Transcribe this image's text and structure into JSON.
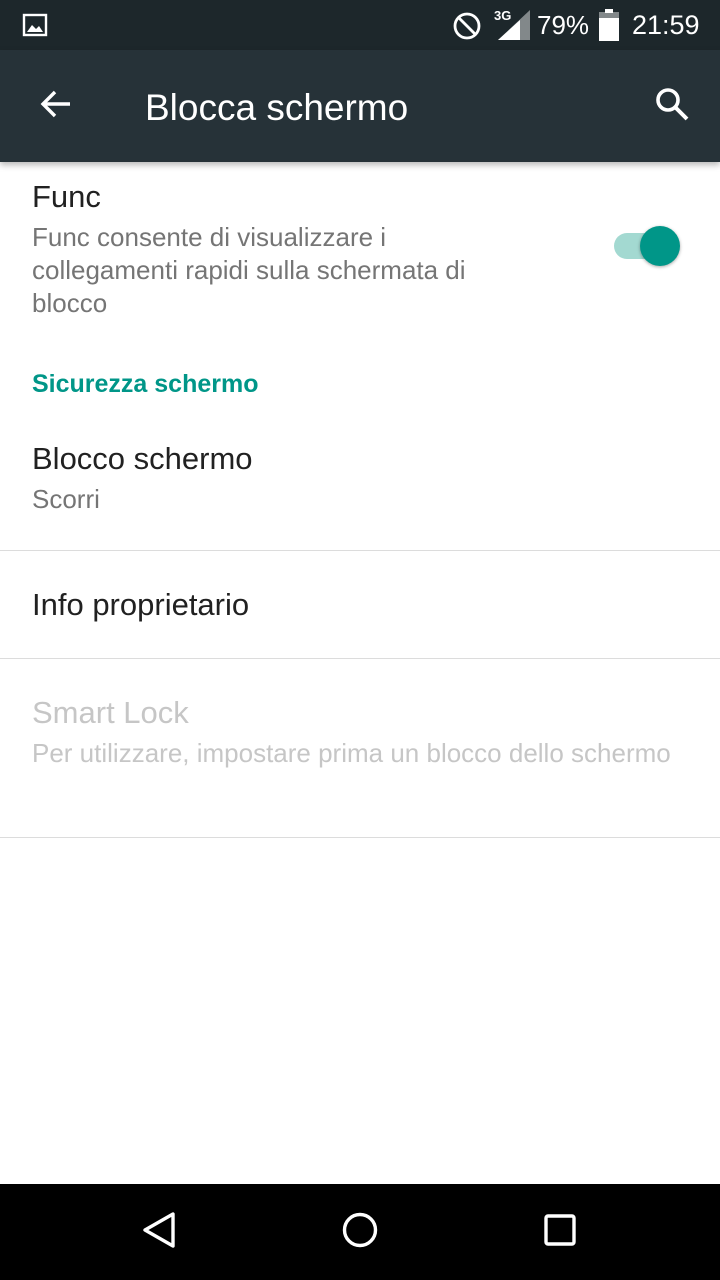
{
  "status_bar": {
    "network_type": "3G",
    "battery_percent": "79%",
    "time": "21:59",
    "icons": [
      "gallery-icon",
      "do-not-disturb-icon",
      "signal-icon",
      "battery-icon"
    ]
  },
  "app_bar": {
    "title": "Blocca schermo",
    "back_icon": "arrow-back-icon",
    "search_icon": "search-icon",
    "background_color": "#263238"
  },
  "func": {
    "title": "Func",
    "summary": "Func consente di visualizzare i collegamenti rapidi sulla schermata di blocco",
    "enabled": true,
    "accent_color": "#009688"
  },
  "section_security": {
    "header": "Sicurezza schermo"
  },
  "screen_lock": {
    "title": "Blocco schermo",
    "summary": "Scorri"
  },
  "owner_info": {
    "title": "Info proprietario"
  },
  "smart_lock": {
    "title": "Smart Lock",
    "summary": "Per utilizzare, impostare prima un blocco dello schermo",
    "disabled": true
  },
  "nav_bar": {
    "buttons": [
      "nav-back-icon",
      "nav-home-icon",
      "nav-recents-icon"
    ]
  }
}
